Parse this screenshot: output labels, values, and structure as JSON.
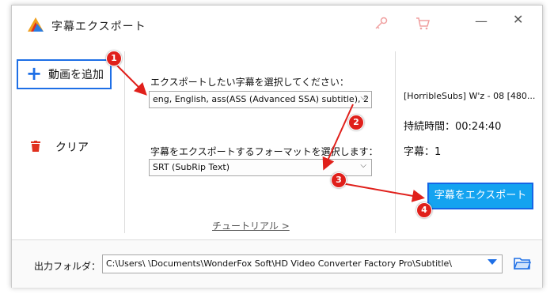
{
  "window": {
    "title": "字幕エクスポート"
  },
  "titlebar": {
    "key_icon": "key-icon",
    "cart_icon": "cart-icon",
    "minimize": "—",
    "close": "✕"
  },
  "sidebar": {
    "add_video_label": "動画を追加",
    "clear_label": "クリア"
  },
  "main": {
    "subtitle_prompt": "エクスポートしたい字幕を選択してください：",
    "subtitle_selected": "eng, English, ass(ASS (Advanced SSA) subtitle), 2",
    "format_prompt": "字幕をエクスポートするフォーマットを選択します：",
    "format_selected": "SRT (SubRip Text)",
    "tutorial_link": "チュートリアル >"
  },
  "info": {
    "file_name": "[HorribleSubs] W'z - 08 [480...",
    "duration": "持続時間：00:24:40",
    "subtitle_count": "字幕：1",
    "export_button": "字幕をエクスポート"
  },
  "footer": {
    "output_label": "出力フォルダ：",
    "output_path": "C:\\Users\\          \\Documents\\WonderFox Soft\\HD Video Converter Factory Pro\\Subtitle\\"
  },
  "annotations": {
    "step1": "1",
    "step2": "2",
    "step3": "3",
    "step4": "4"
  },
  "colors": {
    "accent_blue": "#1e6fe6",
    "export_button": "#14a3f0",
    "annotation_red": "#e0201b"
  }
}
